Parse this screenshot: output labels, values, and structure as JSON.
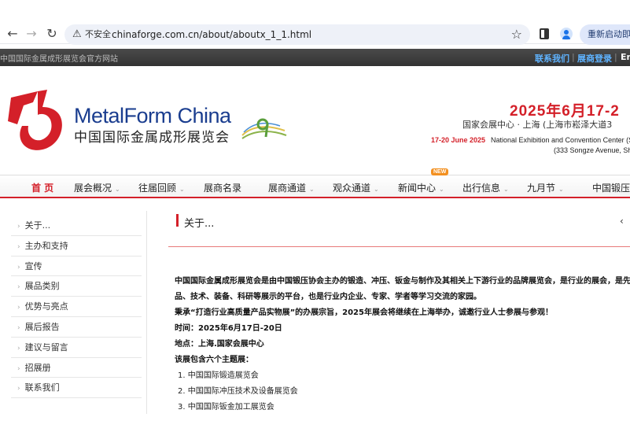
{
  "browser": {
    "back_icon": "arrow-left-icon",
    "forward_icon": "arrow-right-icon",
    "reload_icon": "reload-icon",
    "insecure_label": "不安全",
    "url": "chinaforge.com.cn/about/aboutx_1_1.html",
    "relaunch_label": "重新启动即可更新"
  },
  "topbar": {
    "site_label": "中国国际金属成形展览会官方网站",
    "contact_link": "联系我们",
    "login_link": "展商登录",
    "lang_link": "En",
    "separator": "|"
  },
  "header": {
    "brand_en": "MetalForm China",
    "brand_cn": "中国国际金属成形展览会",
    "date_cn": "2025年6月17-2",
    "venue_cn": "国家会展中心 · 上海 (上海市崧泽大道3",
    "date_en": "17-20 June 2025",
    "venue_en": "National Exhibition and Convention Center (Sh",
    "venue_addr": "(333 Songze Avenue, Sh",
    "colors": {
      "brand_red": "#d42029",
      "brand_blue": "#1a3d8f"
    }
  },
  "nav": {
    "items": [
      {
        "label": "首 页",
        "has_caret": false
      },
      {
        "label": "展会概况",
        "has_caret": true
      },
      {
        "label": "往届回顾",
        "has_caret": true
      },
      {
        "label": "展商名录",
        "has_caret": false
      },
      {
        "label": "展商通道",
        "has_caret": true
      },
      {
        "label": "观众通道",
        "has_caret": true
      },
      {
        "label": "新闻中心",
        "has_caret": true
      },
      {
        "label": "出行信息",
        "has_caret": true
      },
      {
        "label": "九月节",
        "has_caret": true
      },
      {
        "label": "中国锻压",
        "has_caret": false
      }
    ],
    "new_badge": "NEW",
    "caret": "⌄"
  },
  "sidebar": {
    "arrow": "›",
    "items": [
      {
        "label": "关于..."
      },
      {
        "label": "主办和支持"
      },
      {
        "label": "宣传"
      },
      {
        "label": "展品类别"
      },
      {
        "label": "优势与亮点"
      },
      {
        "label": "展后报告"
      },
      {
        "label": "建议与留言"
      },
      {
        "label": "招展册"
      },
      {
        "label": "联系我们"
      }
    ]
  },
  "content": {
    "title": "关于...",
    "title_arrow": "‹",
    "paragraph_line1": "中国国际金属成形展览会是由中国锻压协会主办的锻造、冲压、钣金与制作及其相关上下游行业的品牌展览会，是行业的展会，是先",
    "paragraph_line2": "品、技术、装备、科研等展示的平台，也是行业内企业、专家、学者等学习交流的家园。",
    "paragraph_line3": "秉承“打造行业高质量产品实物展”的办展宗旨，2025年展会将继续在上海举办，诚邀行业人士参展与参观！",
    "time_line": "时间：2025年6月17日-20日",
    "place_line": "地点：上海.国家会展中心",
    "themes_intro": "该展包含六个主题展：",
    "themes": [
      "1. 中国国际锻造展览会",
      "2. 中国国际冲压技术及设备展览会",
      "3. 中国国际钣金加工展览会"
    ]
  }
}
